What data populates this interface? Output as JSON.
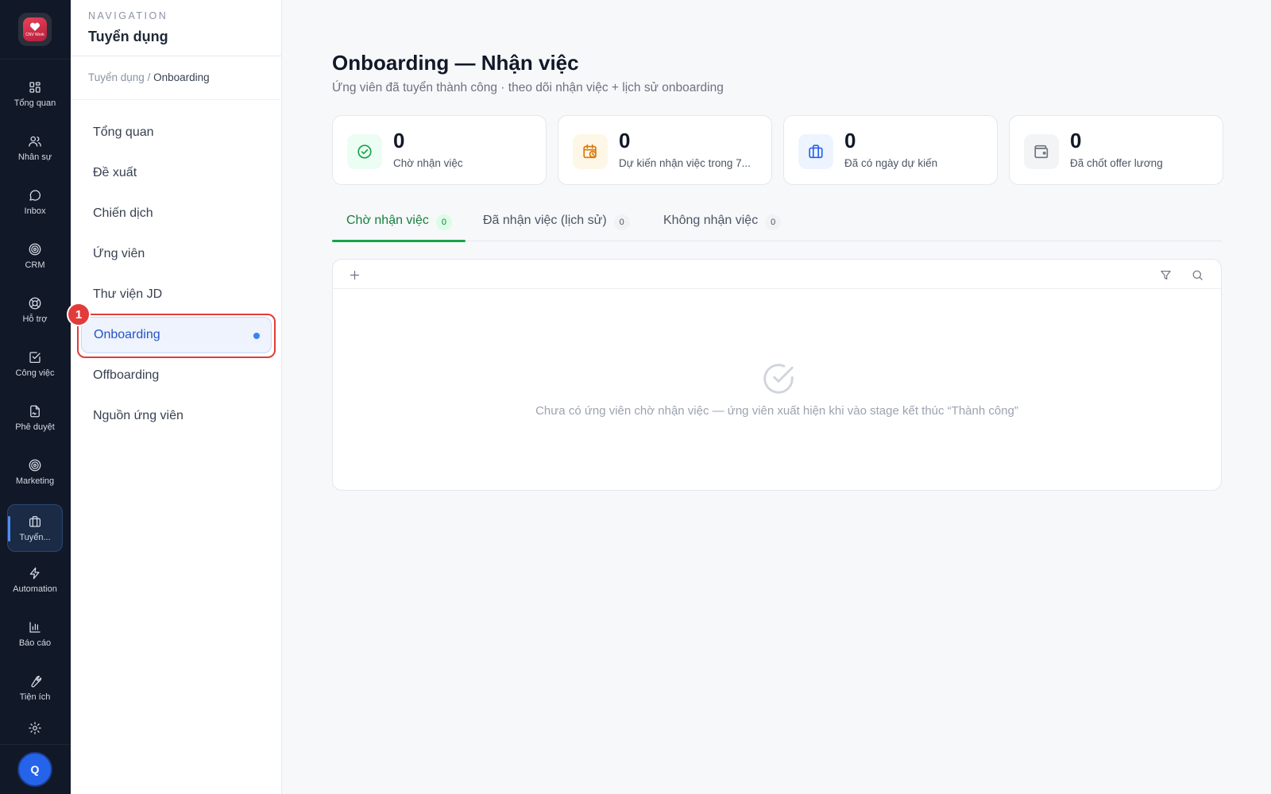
{
  "brand": {
    "logo_text": "CNV Work",
    "accent": "#2563eb",
    "highlight": "#e23b3b"
  },
  "rail": {
    "items": [
      {
        "label": "Tổng quan",
        "icon": "grid-icon"
      },
      {
        "label": "Nhân sự",
        "icon": "users-icon"
      },
      {
        "label": "Inbox",
        "icon": "chat-icon"
      },
      {
        "label": "CRM",
        "icon": "target-icon"
      },
      {
        "label": "Hỗ trợ",
        "icon": "lifebuoy-icon"
      },
      {
        "label": "Công việc",
        "icon": "checkbox-icon"
      },
      {
        "label": "Phê duyệt",
        "icon": "file-sign-icon"
      },
      {
        "label": "Marketing",
        "icon": "target-icon"
      },
      {
        "label": "Tuyển...",
        "icon": "briefcase-icon"
      },
      {
        "label": "Automation",
        "icon": "bolt-icon"
      },
      {
        "label": "Báo cáo",
        "icon": "bar-chart-icon"
      },
      {
        "label": "Tiện ích",
        "icon": "wrench-icon"
      }
    ],
    "settings_icon": "gear-icon",
    "avatar": "Q"
  },
  "subnav": {
    "eyebrow": "NAVIGATION",
    "title": "Tuyển dụng",
    "breadcrumb": {
      "parent": "Tuyển dụng",
      "separator": " / ",
      "current": "Onboarding"
    },
    "items": [
      {
        "label": "Tổng quan"
      },
      {
        "label": "Đề xuất"
      },
      {
        "label": "Chiến dịch"
      },
      {
        "label": "Ứng viên"
      },
      {
        "label": "Thư viện JD"
      },
      {
        "label": "Onboarding"
      },
      {
        "label": "Offboarding"
      },
      {
        "label": "Nguồn ứng viên"
      }
    ],
    "active_index": 5,
    "annotation_badge": "1"
  },
  "main": {
    "title": "Onboarding — Nhận việc",
    "subtitle": "Ứng viên đã tuyển thành công · theo dõi nhận việc + lịch sử onboarding",
    "stats": [
      {
        "value": "0",
        "label": "Chờ nhận việc",
        "icon": "check-circle-icon",
        "color": "#16a34a",
        "bg": "#ecfdf3"
      },
      {
        "value": "0",
        "label": "Dự kiến nhận việc trong 7...",
        "icon": "calendar-clock-icon",
        "color": "#d97706",
        "bg": "#fef6e7"
      },
      {
        "value": "0",
        "label": "Đã có ngày dự kiến",
        "icon": "briefcase-icon",
        "color": "#2563eb",
        "bg": "#eef4ff"
      },
      {
        "value": "0",
        "label": "Đã chốt offer lương",
        "icon": "wallet-icon",
        "color": "#6b7280",
        "bg": "#f3f4f6"
      }
    ],
    "tabs": [
      {
        "label": "Chờ nhận việc",
        "count": "0"
      },
      {
        "label": "Đã nhận việc (lịch sử)",
        "count": "0"
      },
      {
        "label": "Không nhận việc",
        "count": "0"
      }
    ],
    "active_tab": 0,
    "empty_text": "Chưa có ứng viên chờ nhận việc — ứng viên xuất hiện khi vào stage kết thúc “Thành công”"
  }
}
